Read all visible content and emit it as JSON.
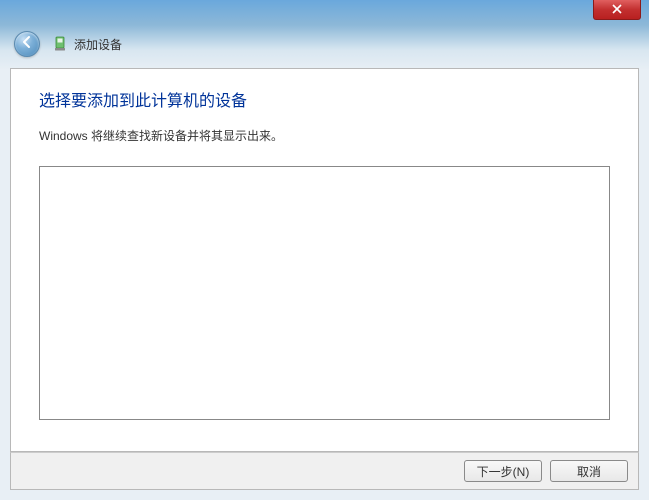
{
  "titlebar": {
    "close_icon": "close"
  },
  "header": {
    "back_icon": "back-arrow",
    "device_icon": "device",
    "title": "添加设备"
  },
  "content": {
    "heading": "选择要添加到此计算机的设备",
    "subtext": "Windows 将继续查找新设备并将其显示出来。"
  },
  "buttons": {
    "next": "下一步(N)",
    "cancel": "取消"
  }
}
